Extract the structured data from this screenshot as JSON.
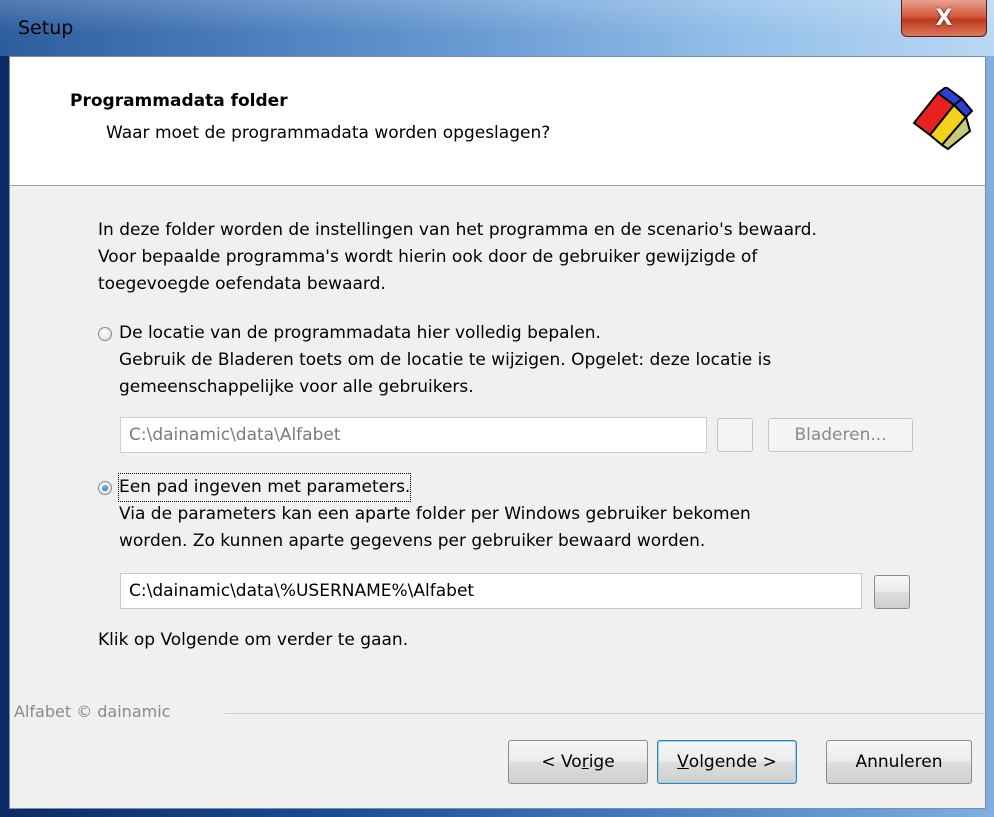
{
  "window": {
    "title": "Setup",
    "close_glyph": "X"
  },
  "header": {
    "title": "Programmadata folder",
    "subtitle": "Waar moet de programmadata worden opgeslagen?",
    "logo_icon": "alfabet-logo-icon"
  },
  "intro": {
    "line1": "In deze folder worden de instellingen van het programma en de scenario's bewaard.",
    "line2": "Voor bepaalde programma's wordt hierin ook door de gebruiker gewijzigde of",
    "line3": "toegevoegde oefendata bewaard."
  },
  "option1": {
    "label": "De locatie van de programmadata hier volledig bepalen.",
    "desc1": "Gebruik de Bladeren toets om de locatie te wijzigen. Opgelet: deze locatie is",
    "desc2": "gemeenschappelijke voor alle gebruikers.",
    "path": "C:\\dainamic\\data\\Alfabet",
    "browse_label": "Bladeren...",
    "checked": false
  },
  "option2": {
    "label": "Een pad ingeven met parameters.",
    "desc1": "Via de parameters kan een aparte folder per Windows gebruiker bekomen",
    "desc2": "worden. Zo kunnen aparte gegevens per gebruiker bewaard worden.",
    "path": "C:\\dainamic\\data\\%USERNAME%\\Alfabet",
    "checked": true
  },
  "hint": "Klik op Volgende om verder te gaan.",
  "brand": "Alfabet © dainamic",
  "buttons": {
    "back": {
      "prefix": "< Vo",
      "accel": "r",
      "suffix": "ige"
    },
    "next": {
      "accel": "V",
      "suffix": "olgende >"
    },
    "cancel": "Annuleren"
  }
}
